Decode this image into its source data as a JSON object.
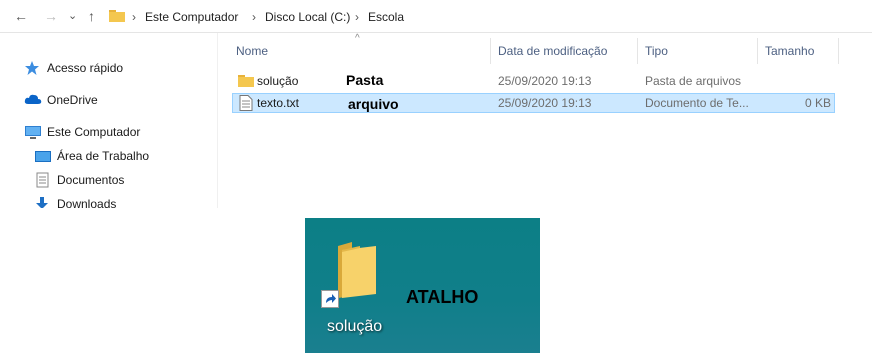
{
  "address_bar": {
    "crumbs": [
      "Este Computador",
      "Disco Local (C:)",
      "Escola"
    ],
    "chevron": "›"
  },
  "nav_pane": {
    "items": [
      {
        "label": "Acesso rápido",
        "icon": "star-icon"
      },
      {
        "label": "OneDrive",
        "icon": "cloud-icon"
      },
      {
        "label": "Este Computador",
        "icon": "computer-icon"
      },
      {
        "label": "Área de Trabalho",
        "icon": "desktop-icon"
      },
      {
        "label": "Documentos",
        "icon": "document-icon"
      },
      {
        "label": "Downloads",
        "icon": "download-icon"
      }
    ]
  },
  "list": {
    "headers": {
      "name": "Nome",
      "date": "Data de modificação",
      "type": "Tipo",
      "size": "Tamanho"
    },
    "rows": [
      {
        "name": "solução",
        "date": "25/09/2020 19:13",
        "type": "Pasta de arquivos",
        "size": "",
        "annotation": "Pasta",
        "icon": "folder-icon",
        "selected": false
      },
      {
        "name": "texto.txt",
        "date": "25/09/2020 19:13",
        "type": "Documento de Te...",
        "size": "0 KB",
        "annotation": "arquivo",
        "icon": "text-file-icon",
        "selected": true
      }
    ]
  },
  "desktop": {
    "shortcut_label": "solução",
    "annotation": "ATALHO",
    "background_color": "#0f7f88"
  },
  "colors": {
    "selection": "#cce8ff",
    "selection_border": "#99d1ff",
    "folder": "#f4c74f",
    "accent": "#0078d7"
  }
}
